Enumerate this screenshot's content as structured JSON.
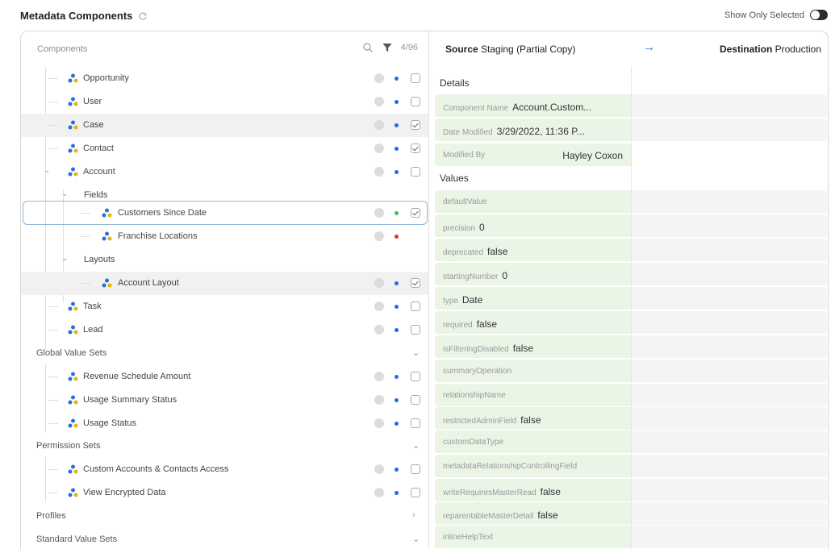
{
  "header": {
    "title": "Metadata Components",
    "show_only_selected": "Show Only Selected"
  },
  "components_panel": {
    "label": "Components",
    "count": "4/96"
  },
  "tree": {
    "opportunity": "Opportunity",
    "user": "User",
    "case": "Case",
    "contact": "Contact",
    "account": "Account",
    "fields": "Fields",
    "customers_since_date": "Customers Since Date",
    "franchise_locations": "Franchise Locations",
    "layouts": "Layouts",
    "account_layout": "Account Layout",
    "task": "Task",
    "lead": "Lead",
    "global_value_sets": "Global Value Sets",
    "revenue_schedule_amount": "Revenue Schedule Amount",
    "usage_summary_status": "Usage Summary Status",
    "usage_status": "Usage Status",
    "permission_sets": "Permission Sets",
    "custom_accounts_contacts_access": "Custom Accounts & Contacts Access",
    "view_encrypted_data": "View Encrypted Data",
    "profiles": "Profiles",
    "standard_value_sets": "Standard Value Sets"
  },
  "compare": {
    "source_label": "Source",
    "source_value": "Staging (Partial Copy)",
    "destination_label": "Destination",
    "destination_value": "Production",
    "details_title": "Details",
    "component_name_key": "Component Name",
    "component_name_val": "Account.Custom...",
    "date_modified_key": "Date Modified",
    "date_modified_val": "3/29/2022, 11:36 P...",
    "modified_by_key": "Modified By",
    "modified_by_val": "Hayley Coxon",
    "values_title": "Values",
    "default_value_key": "defaultValue",
    "precision_key": "precision",
    "precision_val": "0",
    "deprecated_key": "deprecated",
    "deprecated_val": "false",
    "starting_number_key": "startingNumber",
    "starting_number_val": "0",
    "type_key": "type",
    "type_val": "Date",
    "required_key": "required",
    "required_val": "false",
    "is_filtering_disabled_key": "isFilteringDisabled",
    "is_filtering_disabled_val": "false",
    "summary_operation_key": "summaryOperation",
    "relationship_name_key": "relationshipName",
    "restricted_admin_field_key": "restrictedAdminField",
    "restricted_admin_field_val": "false",
    "custom_data_type_key": "customDataType",
    "metadata_rel_key": "metadataRelationshipControllingField",
    "write_requires_key": "writeRequiresMasterRead",
    "write_requires_val": "false",
    "reparentable_key": "reparentableMasterDetail",
    "reparentable_val": "false",
    "inline_help_key": "inlineHelpText"
  },
  "colors": {
    "accent_blue": "#2b7be0",
    "dot_blue": "#1f6fe0",
    "dot_green": "#3fbf5a",
    "dot_red": "#e03030",
    "value_bg": "#eaf5e6"
  }
}
